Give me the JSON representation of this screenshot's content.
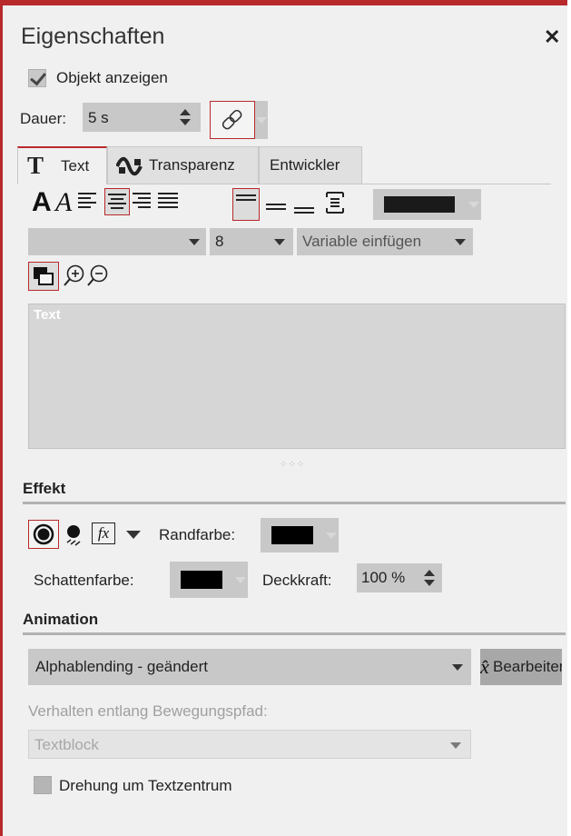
{
  "header": {
    "title": "Eigenschaften",
    "close_glyph": "✕"
  },
  "show_object": {
    "label": "Objekt anzeigen",
    "checked": true
  },
  "duration": {
    "label": "Dauer:",
    "value": "5 s"
  },
  "link_icon": "link-icon",
  "tabs": [
    {
      "label": "Text",
      "icon": "text-t-icon",
      "active": true
    },
    {
      "label": "Transparenz",
      "icon": "transparency-icon",
      "active": false
    },
    {
      "label": "Entwickler",
      "icon": "",
      "active": false
    }
  ],
  "toolbar": {
    "bold_glyph": "A",
    "italic_glyph": "A",
    "text_color": "#1a1a1a"
  },
  "font": {
    "family_value": "",
    "size_value": "8",
    "variable_placeholder": "Variable einfügen"
  },
  "editor": {
    "text": "Text"
  },
  "effect": {
    "title": "Effekt",
    "fx_glyph": "fx",
    "border_color_label": "Randfarbe:",
    "border_color": "#000000",
    "shadow_color_label": "Schattenfarbe:",
    "shadow_color": "#000000",
    "opacity_label": "Deckkraft:",
    "opacity_value": "100 %"
  },
  "animation": {
    "title": "Animation",
    "selected": "Alphablending - geändert",
    "edit_button": "Bearbeiten",
    "path_behavior_label": "Verhalten entlang Bewegungspfad:",
    "path_behavior_value": "Textblock",
    "rotate_label": "Drehung um Textzentrum",
    "rotate_checked": false
  },
  "colors": {
    "accent": "#b8292c",
    "panel_bg": "#f0f0f0",
    "field_bg": "#c8c8c8"
  }
}
